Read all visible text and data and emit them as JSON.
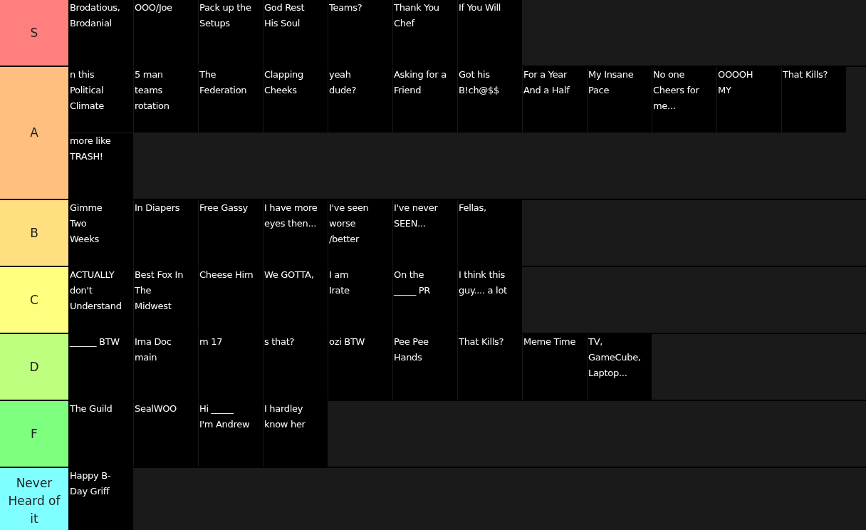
{
  "tiers": [
    {
      "label": "S",
      "color": "#ff7f7f",
      "tiles": [
        "Brodatious,\nBrodanial",
        "OOO/Joe",
        "Pack up the\nSetups",
        "God Rest\nHis Soul",
        "Teams?",
        "Thank You\nChef",
        "If You Will"
      ]
    },
    {
      "label": "A",
      "color": "#ffbf7f",
      "tiles": [
        "n this\nPolitical\nClimate",
        "5 man\nteams\nrotation",
        "The\nFederation",
        "Clapping\nCheeks",
        "yeah\ndude?",
        "Asking for a\nFriend",
        "Got his\nB!ch@$$",
        "For a Year\nAnd a Half",
        "My Insane\nPace",
        "No one\nCheers for\nme...",
        "OOOOH\nMY",
        "That Kills?",
        "more like\nTRASH!"
      ]
    },
    {
      "label": "B",
      "color": "#ffdf7f",
      "tiles": [
        "Gimme\nTwo\nWeeks",
        "In Diapers",
        "Free Gassy",
        "I have more\neyes then...",
        "I've seen\nworse\n/better",
        "I've never\nSEEN...",
        "Fellas,"
      ]
    },
    {
      "label": "C",
      "color": "#ffff7f",
      "tiles": [
        "ACTUALLY\ndon't\nUnderstand",
        "Best Fox In\nThe\nMidwest",
        "Cheese Him",
        "We GOTTA,",
        "I am\nIrate",
        "On the\n_____ PR",
        "I think this\nguy.... a lot"
      ]
    },
    {
      "label": "D",
      "color": "#bfff7f",
      "tiles": [
        "______ BTW",
        "Ima Doc\nmain",
        "m 17",
        "s that?",
        "ozi BTW",
        "Pee Pee\nHands",
        "That Kills?",
        "Meme Time",
        "TV,\nGameCube,\nLaptop..."
      ]
    },
    {
      "label": "F",
      "color": "#7fff7f",
      "tiles": [
        "The Guild",
        "SealWOO",
        "Hi _____\nI'm Andrew",
        "I hardley\nknow her"
      ]
    },
    {
      "label": "Never Heard of it",
      "color": "#7fffff",
      "tiles": [
        "Happy B-\nDay Griff"
      ]
    }
  ]
}
